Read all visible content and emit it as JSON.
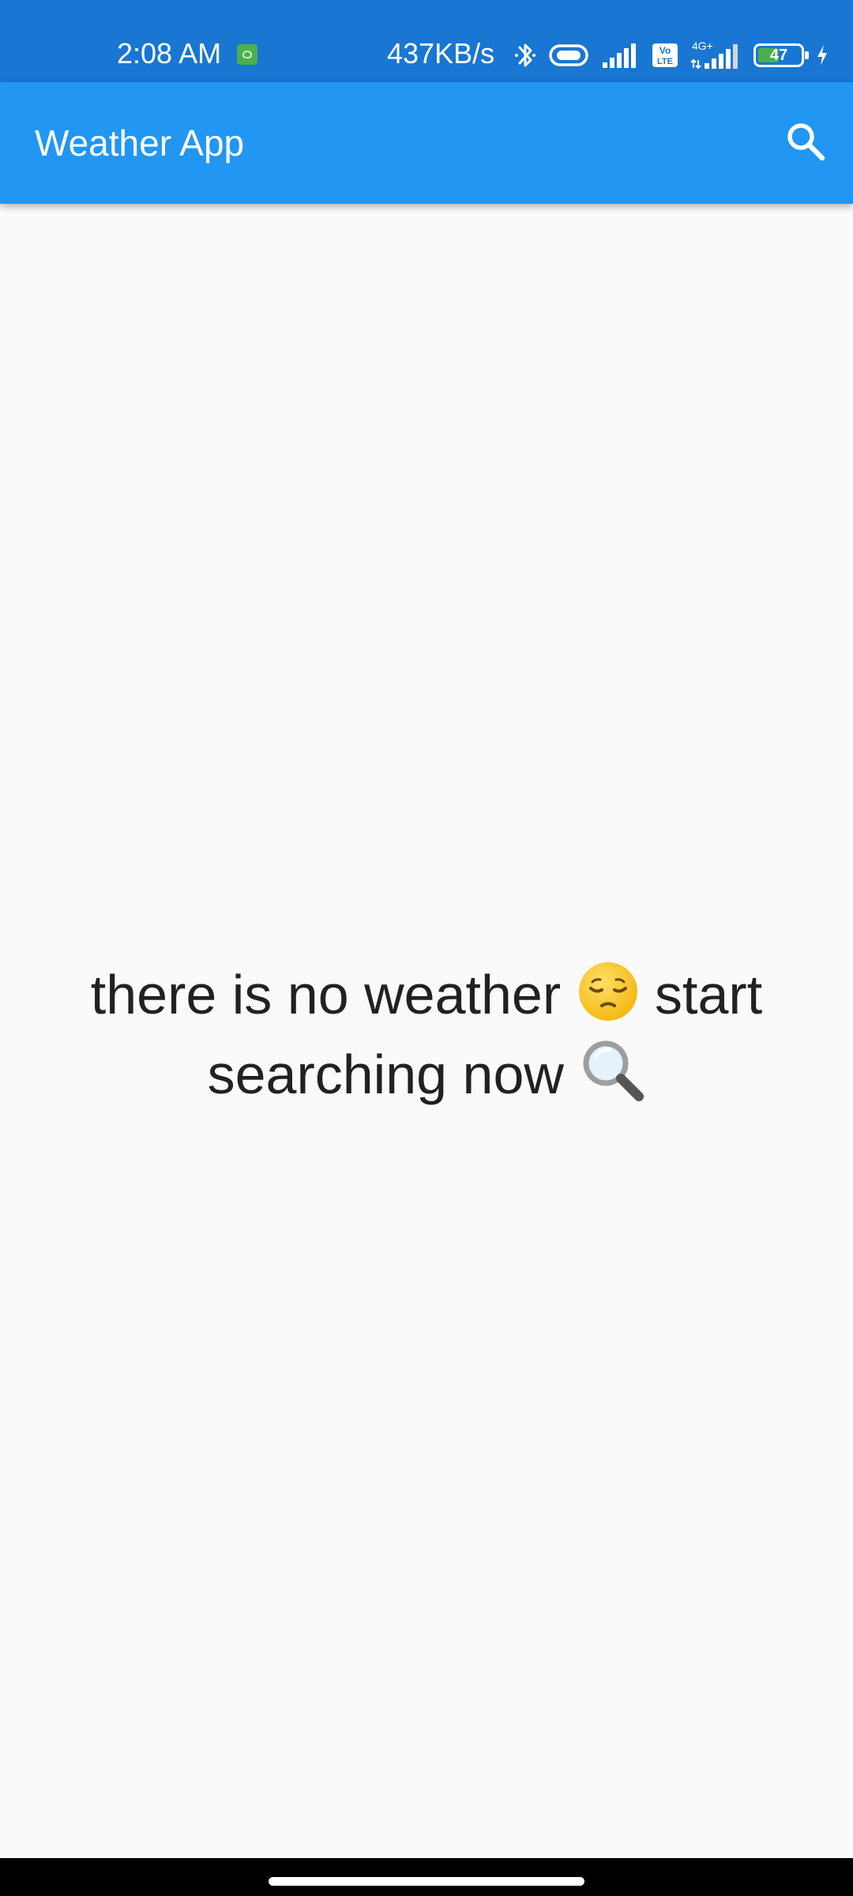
{
  "status_bar": {
    "time": "2:08 AM",
    "speed": "437KB/s",
    "battery_level": "47",
    "icons": [
      "app-notification-icon",
      "bluetooth-icon",
      "link-icon",
      "signal-icon",
      "volte-icon",
      "4g-signal-icon",
      "battery-icon",
      "charging-icon"
    ]
  },
  "app_bar": {
    "title": "Weather App",
    "search_icon": "search-icon",
    "color": "#2196f3"
  },
  "main": {
    "empty_text_part1": "there is no weather",
    "emoji_sad": "😔",
    "empty_text_part2": "start searching now",
    "emoji_search": "🔍"
  },
  "colors": {
    "status_bar": "#1976d2",
    "app_bar": "#2196f3",
    "background": "#fafafa",
    "text": "#212121"
  }
}
